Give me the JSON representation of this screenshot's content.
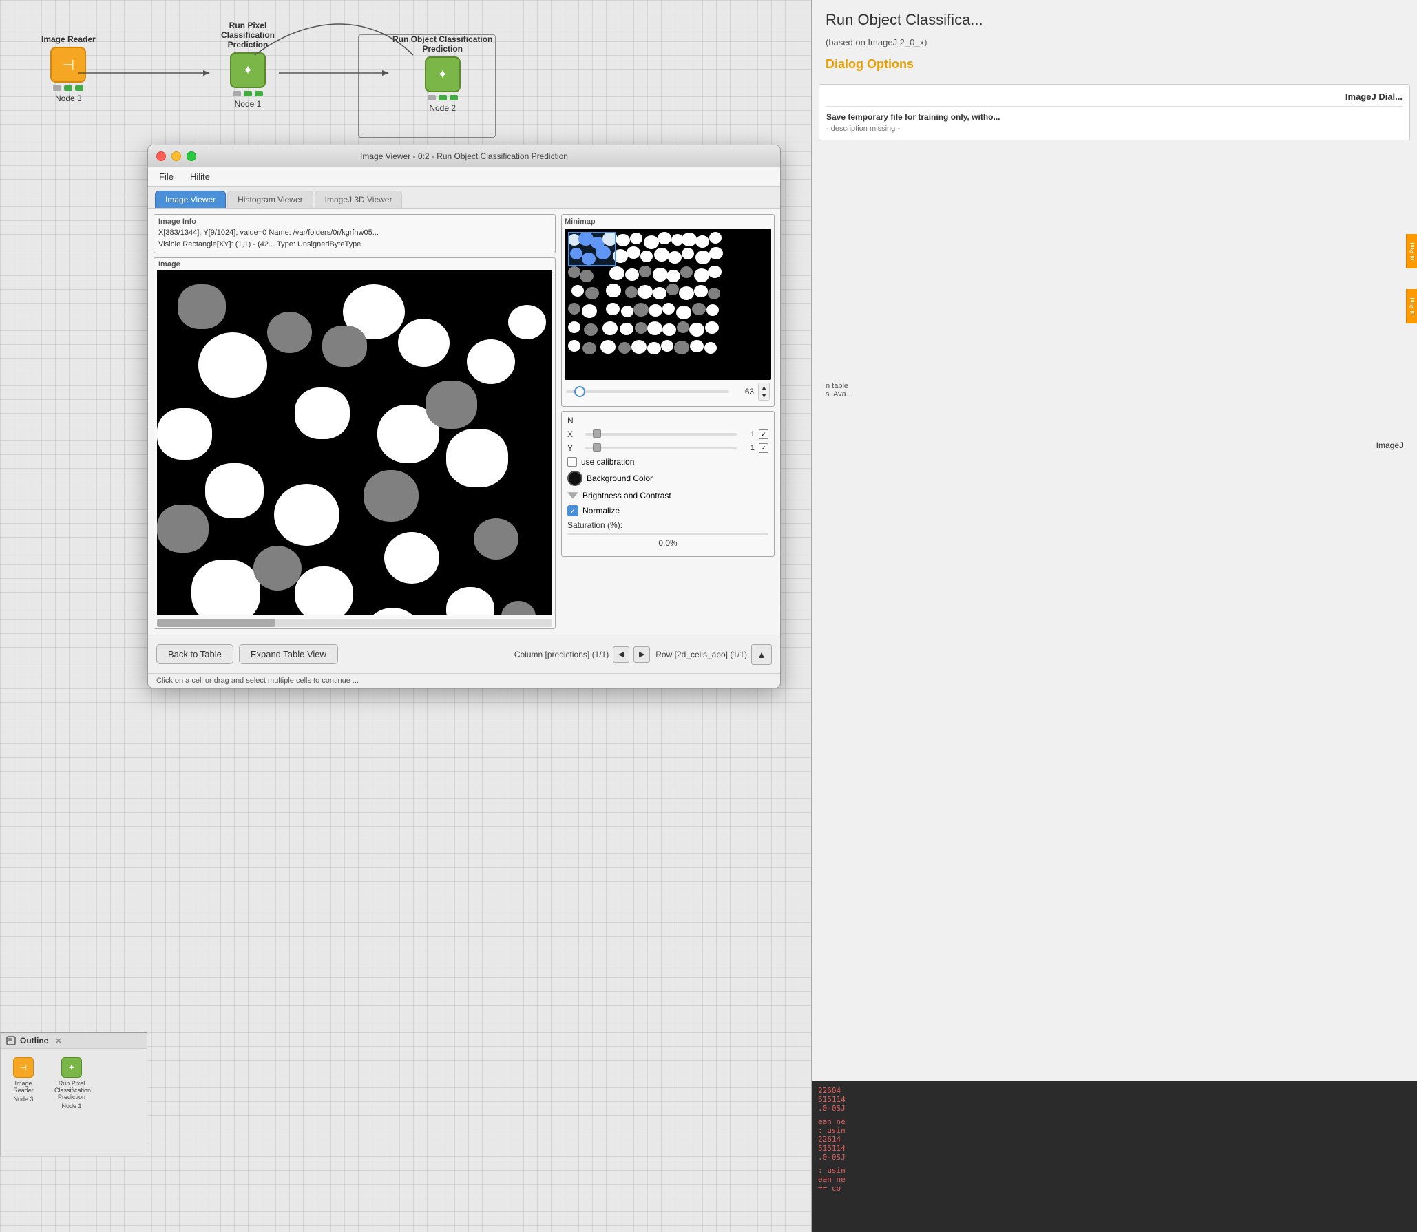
{
  "workflow": {
    "title": "Image Viewer - 0:2 - Run Object Classification Prediction",
    "nodes": [
      {
        "id": "node3",
        "label": "Image Reader",
        "sublabel": "Node 3",
        "type": "orange",
        "icon": "→"
      },
      {
        "id": "node1",
        "label": "Run Pixel Classification\nPrediction",
        "sublabel": "Node 1",
        "type": "green",
        "icon": "⚙"
      },
      {
        "id": "node2",
        "label": "Run Object Classification\nPrediction",
        "sublabel": "Node 2",
        "type": "green",
        "icon": "⚙"
      }
    ]
  },
  "right_panel": {
    "title": "Run Object Classifica...",
    "subtitle": "(based on ImageJ 2_0_x)",
    "dialog_options_label": "Dialog Options",
    "section_header": "ImageJ Dial...",
    "section_desc": "Save temporary file for training only, witho...",
    "section_subdesc": "- description missing -",
    "output_port1_label": "ut Port",
    "output_port2_label": "ut Port",
    "imagej_label": "ImageJ",
    "log_lines": [
      "22604",
      "515114",
      ".0-0SJ",
      "",
      "ean ne",
      ": usin",
      "22614",
      "515114",
      ".0-0SJ",
      "",
      ": usin",
      "ean ne",
      "== co"
    ]
  },
  "image_viewer": {
    "title": "Image Viewer - 0:2 - Run Object Classification Prediction",
    "menu": {
      "file_label": "File",
      "hilite_label": "Hilite"
    },
    "tabs": [
      {
        "id": "image-viewer",
        "label": "Image Viewer",
        "active": true
      },
      {
        "id": "histogram-viewer",
        "label": "Histogram Viewer",
        "active": false
      },
      {
        "id": "imagej-3d-viewer",
        "label": "ImageJ 3D Viewer",
        "active": false
      }
    ],
    "image_info": {
      "box_label": "Image Info",
      "line1": "X[383/1344]; Y[9/1024]; value=0  Name: /var/folders/0r/kgrfhw05...",
      "line2": "Visible Rectangle[XY]: (1,1) - (42...  Type: UnsignedByteType"
    },
    "image_box_label": "Image",
    "minimap": {
      "label": "Minimap"
    },
    "zoom": {
      "value": "63"
    },
    "controls": {
      "n_label": "N",
      "x_label": "X",
      "y_label": "Y",
      "x_value": "1",
      "y_value": "1",
      "use_calibration_label": "use calibration",
      "background_color_label": "Background Color",
      "brightness_contrast_label": "Brightness and Contrast",
      "normalize_label": "Normalize",
      "saturation_label": "Saturation (%):",
      "saturation_value": "0.0%"
    },
    "toolbar": {
      "back_label": "Back to Table",
      "expand_label": "Expand Table View",
      "col_nav_label": "Column [predictions] (1/1)",
      "row_nav_label": "Row [2d_cells_apo] (1/1)"
    },
    "statusbar": {
      "text": "Click on a cell or drag and select multiple cells to continue ..."
    }
  },
  "outline": {
    "header_label": "Outline",
    "nodes": [
      {
        "label": "Image Reader\nNode 3",
        "type": "orange",
        "icon": "→"
      },
      {
        "label": "Run Pixel Classification\nPrediction\nNode 1",
        "type": "green",
        "icon": "⚙"
      }
    ]
  }
}
